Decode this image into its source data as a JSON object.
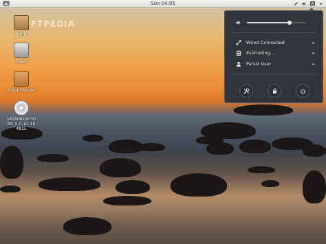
{
  "topbar": {
    "clock": "Sun 04:05",
    "tray_icons": [
      "pencil-icon",
      "volume-icon",
      "power-icon",
      "chevron-down-icon"
    ]
  },
  "watermark": "SOFTPEDIA",
  "desktop": {
    "icons": [
      {
        "label": "Home",
        "icon": "folder-icon"
      },
      {
        "label": "Trash",
        "icon": "trash-icon"
      },
      {
        "label": "Install Parsix",
        "icon": "installer-icon"
      },
      {
        "label": "VBOXADDITIONS_5.0.12_104815",
        "icon": "disc-icon"
      }
    ]
  },
  "menu": {
    "volume_level": 0.72,
    "items": [
      {
        "label": "Wired Connected",
        "icon": "network-wired-icon"
      },
      {
        "label": "Estimating…",
        "icon": "battery-icon"
      },
      {
        "label": "Parsix User",
        "icon": "user-icon"
      }
    ],
    "buttons": [
      "settings-icon",
      "lock-icon",
      "power-icon"
    ]
  },
  "colors": {
    "menu_bg": "#31343a",
    "topbar_bg": "#e8e8e6"
  }
}
